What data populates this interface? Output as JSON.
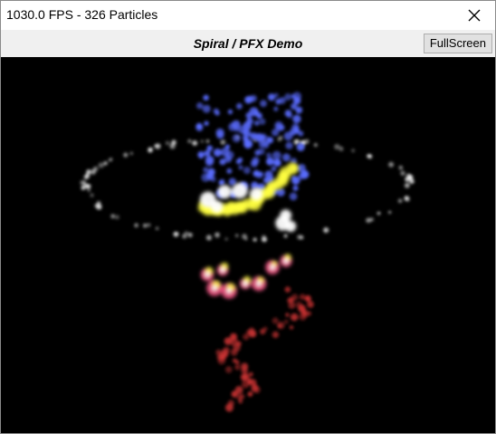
{
  "window": {
    "title": "1030.0 FPS - 326 Particles",
    "close_icon": "close-icon"
  },
  "toolbar": {
    "title": "Spiral / PFX Demo",
    "fullscreen_label": "FullScreen"
  },
  "colors": {
    "background": "#000000",
    "blue_particles": "#5a6cff",
    "white_particles": "#ffffff",
    "yellow_particles": "#ffff40",
    "pink_particles": "#ff5a8c",
    "red_particles": "#c83232"
  }
}
